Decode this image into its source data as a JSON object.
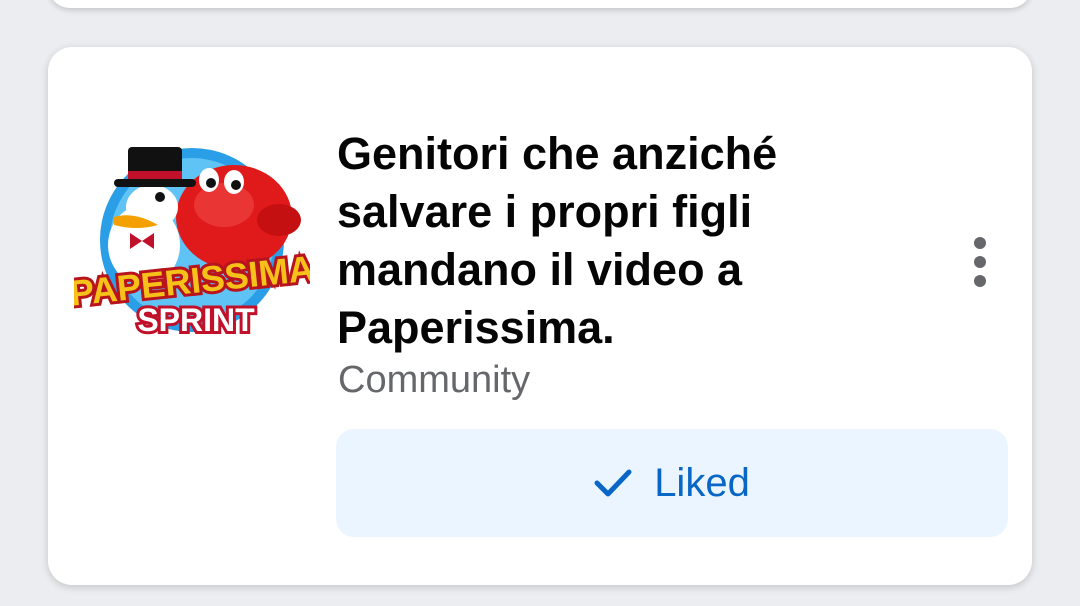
{
  "post": {
    "title": "Genitori che anziché salvare i propri figli mandano il video a Paperissima.",
    "category": "Community",
    "avatar": {
      "logo_text_top": "PAPERISSIMA",
      "logo_text_bottom": "SPRINT"
    }
  },
  "actions": {
    "liked_label": "Liked",
    "liked_icon": "check-icon",
    "more_icon": "more-vertical-icon"
  },
  "colors": {
    "liked_bg": "#ebf5ff",
    "liked_text": "#0866c6",
    "title_text": "#050505",
    "secondary_text": "#65676b"
  }
}
